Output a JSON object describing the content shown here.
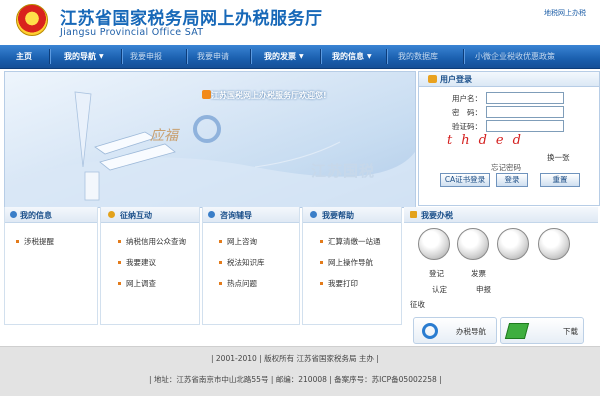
{
  "header": {
    "title": "江苏省国家税务局网上办税服务厅",
    "subtitle": "Jiangsu Provincial Office SAT",
    "top_link": "地税网上办税"
  },
  "nav": [
    {
      "label": "主页",
      "active": true
    },
    {
      "label": "我的导航",
      "active": true,
      "caret": true
    },
    {
      "label": "我要申报",
      "active": false
    },
    {
      "label": "我要申请",
      "active": false
    },
    {
      "label": "我的发票",
      "active": true,
      "caret": true
    },
    {
      "label": "我的信息",
      "active": true,
      "caret": true
    },
    {
      "label": "我的数据库",
      "active": false
    },
    {
      "label": "小微企业税收优惠政策",
      "active": false
    }
  ],
  "banner": {
    "welcome": "江苏国税网上办税服务厅欢迎您!",
    "watermark": "江苏国税",
    "script": "应福"
  },
  "login": {
    "title": "用户登录",
    "username_label": "用户名：",
    "password_label": "密　码：",
    "captcha_label": "验证码：",
    "captcha": "thded",
    "refresh": "换一张",
    "forgot": "忘记密码",
    "btn_ca": "CA证书登录",
    "btn_login": "登录",
    "btn_reset": "重置"
  },
  "columns": {
    "my_info": {
      "title": "我的信息",
      "items": [
        "涉税提醒"
      ]
    },
    "interaction": {
      "title": "征纳互动",
      "items": [
        "纳税信用公众查询",
        "我要建议",
        "网上调查"
      ]
    },
    "consult": {
      "title": "咨询辅导",
      "items": [
        "网上咨询",
        "税法知识库",
        "热点问题"
      ]
    },
    "help": {
      "title": "我要帮助",
      "items": [
        "汇算清缴一站通",
        "网上操作导航",
        "我要打印"
      ]
    },
    "service": {
      "title": "我要办税",
      "labels": [
        "登记",
        "发票",
        "认定",
        "申报",
        "征收"
      ]
    }
  },
  "quick": {
    "nav": "办税导航",
    "download": "下载"
  },
  "footer": {
    "line1": "| 2001-2010 | 版权所有 江苏省国家税务局 主办 |",
    "line2": "| 地址：江苏省南京市中山北路55号 | 邮编：210008 | 备案序号：苏ICP备05002258 |"
  },
  "colors": {
    "nav_blue": "#1a5fae",
    "title_blue": "#1768b8",
    "captcha_red": "#d4201f",
    "bullet_orange": "#e37b1b"
  }
}
